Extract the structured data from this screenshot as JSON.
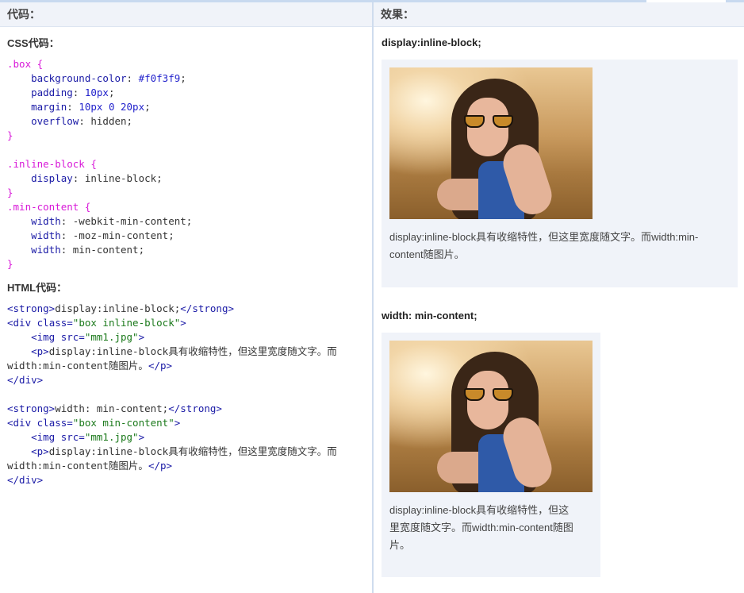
{
  "header": {
    "left_title": "代码：",
    "right_title": "效果："
  },
  "code_panel": {
    "css_title": "CSS代码：",
    "html_title": "HTML代码：",
    "css_lines": [
      [
        {
          "t": ".box {",
          "c": "sel"
        }
      ],
      [
        {
          "t": "    background-color",
          "c": "prop"
        },
        {
          "t": ": ",
          "c": "plain"
        },
        {
          "t": "#f0f3f9",
          "c": "val"
        },
        {
          "t": ";",
          "c": "plain"
        }
      ],
      [
        {
          "t": "    padding",
          "c": "prop"
        },
        {
          "t": ": ",
          "c": "plain"
        },
        {
          "t": "10px",
          "c": "val"
        },
        {
          "t": ";",
          "c": "plain"
        }
      ],
      [
        {
          "t": "    margin",
          "c": "prop"
        },
        {
          "t": ": ",
          "c": "plain"
        },
        {
          "t": "10px 0 20px",
          "c": "val"
        },
        {
          "t": ";",
          "c": "plain"
        }
      ],
      [
        {
          "t": "    overflow",
          "c": "prop"
        },
        {
          "t": ": hidden;",
          "c": "plain"
        }
      ],
      [
        {
          "t": "}",
          "c": "sel"
        }
      ],
      [
        {
          "t": "",
          "c": "plain"
        }
      ],
      [
        {
          "t": ".inline-block {",
          "c": "sel"
        }
      ],
      [
        {
          "t": "    display",
          "c": "prop"
        },
        {
          "t": ": inline-block;",
          "c": "plain"
        }
      ],
      [
        {
          "t": "}",
          "c": "sel"
        }
      ],
      [
        {
          "t": ".min-content {",
          "c": "sel"
        }
      ],
      [
        {
          "t": "    width",
          "c": "prop"
        },
        {
          "t": ": -webkit-min-content;",
          "c": "plain"
        }
      ],
      [
        {
          "t": "    width",
          "c": "prop"
        },
        {
          "t": ": -moz-min-content;",
          "c": "plain"
        }
      ],
      [
        {
          "t": "    width",
          "c": "prop"
        },
        {
          "t": ": min-content;",
          "c": "plain"
        }
      ],
      [
        {
          "t": "}",
          "c": "sel"
        }
      ]
    ],
    "html_lines": [
      [
        {
          "t": "<strong>",
          "c": "tag"
        },
        {
          "t": "display:inline-block;",
          "c": "plain"
        },
        {
          "t": "</strong>",
          "c": "tag"
        }
      ],
      [
        {
          "t": "<div ",
          "c": "tag"
        },
        {
          "t": "class=",
          "c": "attr"
        },
        {
          "t": "\"box inline-block\"",
          "c": "str"
        },
        {
          "t": ">",
          "c": "tag"
        }
      ],
      [
        {
          "t": "    <img ",
          "c": "tag"
        },
        {
          "t": "src=",
          "c": "attr"
        },
        {
          "t": "\"mm1.jpg\"",
          "c": "str"
        },
        {
          "t": ">",
          "c": "tag"
        }
      ],
      [
        {
          "t": "    <p>",
          "c": "tag"
        },
        {
          "t": "display:inline-block具有收缩特性，但这里宽度随文字。而",
          "c": "plain"
        }
      ],
      [
        {
          "t": "width:min-content随图片。",
          "c": "plain"
        },
        {
          "t": "</p>",
          "c": "tag"
        }
      ],
      [
        {
          "t": "</div>",
          "c": "tag"
        }
      ],
      [
        {
          "t": "",
          "c": "plain"
        }
      ],
      [
        {
          "t": "<strong>",
          "c": "tag"
        },
        {
          "t": "width: min-content;",
          "c": "plain"
        },
        {
          "t": "</strong>",
          "c": "tag"
        }
      ],
      [
        {
          "t": "<div ",
          "c": "tag"
        },
        {
          "t": "class=",
          "c": "attr"
        },
        {
          "t": "\"box min-content\"",
          "c": "str"
        },
        {
          "t": ">",
          "c": "tag"
        }
      ],
      [
        {
          "t": "    <img ",
          "c": "tag"
        },
        {
          "t": "src=",
          "c": "attr"
        },
        {
          "t": "\"mm1.jpg\"",
          "c": "str"
        },
        {
          "t": ">",
          "c": "tag"
        }
      ],
      [
        {
          "t": "    <p>",
          "c": "tag"
        },
        {
          "t": "display:inline-block具有收缩特性，但这里宽度随文字。而",
          "c": "plain"
        }
      ],
      [
        {
          "t": "width:min-content随图片。",
          "c": "plain"
        },
        {
          "t": "</p>",
          "c": "tag"
        }
      ],
      [
        {
          "t": "</div>",
          "c": "tag"
        }
      ]
    ]
  },
  "demo_panel": {
    "demo1_title": "display:inline-block;",
    "demo1_caption": "display:inline-block具有收缩特性，但这里宽度随文字。而width:min-content随图片。",
    "demo2_title": "width: min-content;",
    "demo2_caption_lines": [
      "display:inline-block具有收缩特性，但这",
      "里宽度随文字。而width:min-content随图",
      "片。"
    ],
    "box_background": "#f0f3f9"
  },
  "colors": {
    "selector": "#d819d8",
    "property": "#1a1aa6",
    "string": "#1c7a1c",
    "header_bg": "#f0f3f9"
  }
}
